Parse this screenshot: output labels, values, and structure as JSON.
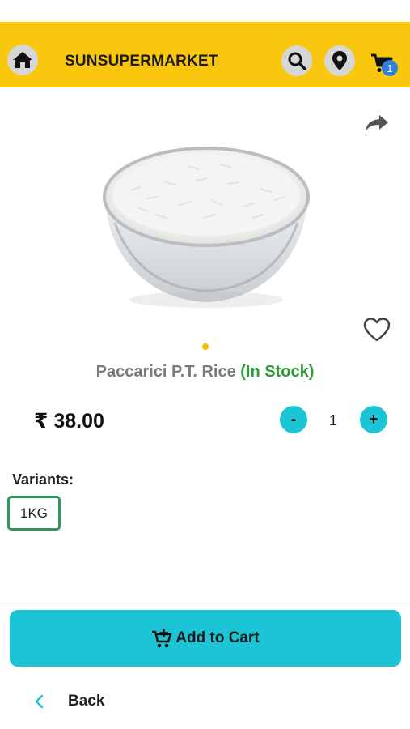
{
  "header": {
    "brand": "SUNSUPERMARKET",
    "cart_count": "1",
    "background": "#f9c80e",
    "icons": [
      "home-icon",
      "search-icon",
      "location-pin-icon",
      "cart-icon"
    ]
  },
  "product": {
    "image": "rice-bowl-image",
    "name": "Paccarici P.T. Rice",
    "stock_status": "(In Stock)",
    "price": "₹ 38.00",
    "quantity": "1",
    "minus_label": "-",
    "plus_label": "+",
    "carousel_active_index": 1,
    "carousel_count": 1,
    "actions": [
      "share-icon",
      "heart-icon"
    ]
  },
  "variants": {
    "label": "Variants:",
    "options": [
      "1KG"
    ],
    "selected": "1KG"
  },
  "footer": {
    "add_to_cart": "Add to Cart",
    "back": "Back"
  },
  "colors": {
    "accent": "#1cc5d6",
    "in_stock": "#2e9a38",
    "badge": "#2f80d9",
    "variant_border": "#2e9a5a"
  }
}
